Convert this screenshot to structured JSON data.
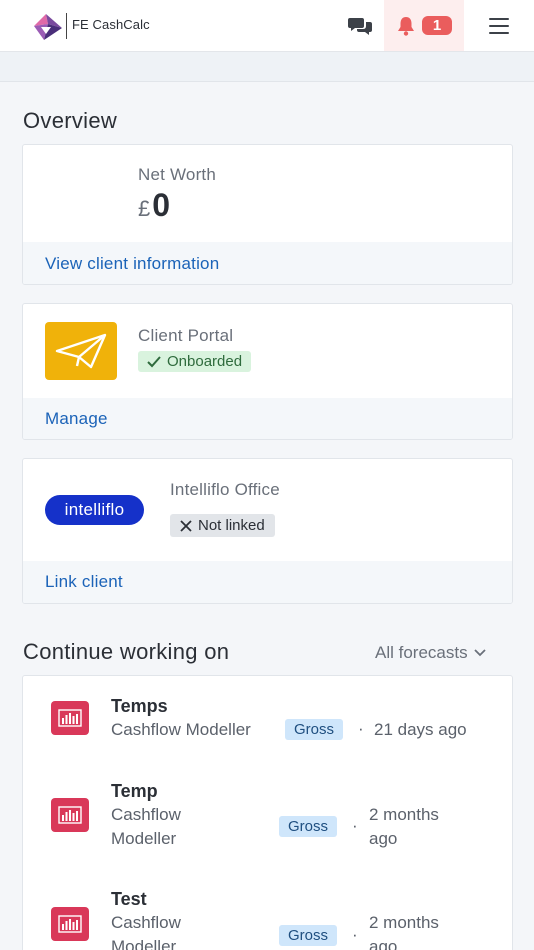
{
  "header": {
    "brand": "FE CashCalc",
    "notification_count": "1",
    "icons": {
      "chat": "chat-bubbles-icon",
      "bell": "bell-icon",
      "menu": "hamburger-menu-icon"
    }
  },
  "overview": {
    "title": "Overview",
    "net_worth": {
      "label": "Net Worth",
      "currency": "£",
      "value": "0",
      "link": "View client information"
    },
    "portal": {
      "label": "Client Portal",
      "status": "Onboarded",
      "link": "Manage"
    },
    "intelliflo": {
      "logo": "intelliflo",
      "label": "Intelliflo Office",
      "status": "Not linked",
      "link": "Link client"
    }
  },
  "continue": {
    "title": "Continue working on",
    "filter": "All forecasts",
    "items": [
      {
        "title": "Temps",
        "type": "Cashflow Modeller",
        "type_line1": "Cashflow",
        "type_line2": "Modeller",
        "tag": "Gross",
        "time": "21 days ago"
      },
      {
        "title": "Temp",
        "type_line1": "Cashflow",
        "type_line2": "Modeller",
        "tag": "Gross",
        "time_line1": "2 months",
        "time_line2": "ago"
      },
      {
        "title": "Test",
        "type_line1": "Cashflow",
        "type_line2": "Modeller",
        "tag": "Gross",
        "time_line1": "2 months",
        "time_line2": "ago"
      }
    ]
  },
  "colors": {
    "accent": "#1b63b8",
    "notif": "#ea5d5d",
    "portal_icon": "#f0b20a",
    "intelliflo": "#1531c9",
    "work_icon": "#d93859"
  }
}
